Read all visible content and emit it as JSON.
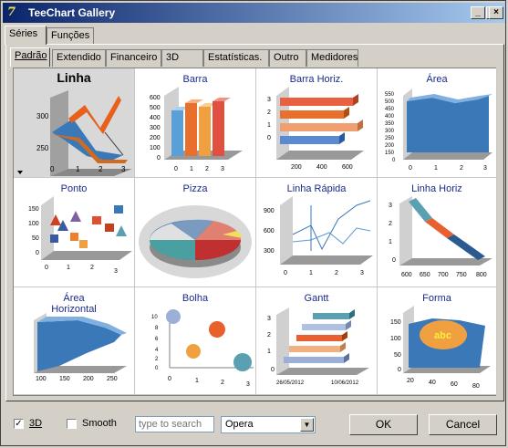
{
  "window": {
    "title": "TeeChart Gallery",
    "icon_name": "teechart-app-icon",
    "minimize": "_",
    "maximize": "□",
    "close": "×"
  },
  "outer_tabs": [
    {
      "label": "Séries",
      "active": true
    },
    {
      "label": "Funções",
      "active": false
    }
  ],
  "inner_tabs": [
    {
      "label": "Padrão",
      "active": true
    },
    {
      "label": "Extendido",
      "active": false
    },
    {
      "label": "Financeiro",
      "active": false
    },
    {
      "label": "3D",
      "active": false
    },
    {
      "label": "Estatísticas.",
      "active": false
    },
    {
      "label": "Outro",
      "active": false
    },
    {
      "label": "Medidores",
      "active": false
    }
  ],
  "gallery": [
    {
      "title": "Linha",
      "selected": true,
      "kind": "line",
      "y_ticks": [
        "250",
        "300"
      ],
      "x_ticks": [
        "0",
        "1",
        "2",
        "3"
      ]
    },
    {
      "title": "Barra",
      "kind": "bar",
      "y_ticks": [
        "0",
        "100",
        "200",
        "300",
        "400",
        "500",
        "600"
      ],
      "x_ticks": [
        "0",
        "1",
        "2",
        "3"
      ]
    },
    {
      "title": "Barra Horiz.",
      "kind": "hbar",
      "y_ticks": [
        "0",
        "1",
        "2",
        "3"
      ],
      "x_ticks": [
        "200",
        "400",
        "600"
      ]
    },
    {
      "title": "Área",
      "kind": "area",
      "y_ticks": [
        "0",
        "150",
        "200",
        "250",
        "300",
        "350",
        "400",
        "450",
        "500",
        "550"
      ],
      "x_ticks": [
        "0",
        "1",
        "2",
        "3"
      ]
    },
    {
      "title": "Ponto",
      "kind": "point",
      "y_ticks": [
        "0",
        "50",
        "100",
        "150"
      ],
      "x_ticks": [
        "0",
        "1",
        "2",
        "3"
      ]
    },
    {
      "title": "Pizza",
      "kind": "pie",
      "y_ticks": [],
      "x_ticks": []
    },
    {
      "title": "Linha Rápida",
      "kind": "fastline",
      "y_ticks": [
        "300",
        "600",
        "900"
      ],
      "x_ticks": [
        "0",
        "1",
        "2",
        "3"
      ]
    },
    {
      "title": "Linha Horiz",
      "kind": "hline",
      "y_ticks": [
        "0",
        "1",
        "2",
        "3"
      ],
      "x_ticks": [
        "600",
        "650",
        "700",
        "750",
        "800"
      ]
    },
    {
      "title": "Área\nHorizontal",
      "kind": "harea",
      "y_ticks": [],
      "x_ticks": [
        "100",
        "150",
        "200",
        "250"
      ]
    },
    {
      "title": "Bolha",
      "kind": "bubble",
      "y_ticks": [
        "0",
        "2",
        "4",
        "6",
        "8",
        "10"
      ],
      "x_ticks": [
        "0",
        "1",
        "2",
        "3"
      ]
    },
    {
      "title": "Gantt",
      "kind": "gantt",
      "y_ticks": [
        "0",
        "1",
        "2",
        "3"
      ],
      "x_ticks": [
        "26/05/2012",
        "10/06/2012"
      ]
    },
    {
      "title": "Forma",
      "kind": "shape",
      "y_ticks": [
        "0",
        "50",
        "100",
        "150"
      ],
      "x_ticks": [
        "20",
        "40",
        "60",
        "80"
      ],
      "shape_text": "abc"
    }
  ],
  "options": {
    "three_d_label": "3D",
    "three_d_checked": true,
    "smooth_label": "Smooth",
    "smooth_checked": false,
    "search_placeholder": "type to search",
    "theme_value": "Opera"
  },
  "buttons": {
    "ok": "OK",
    "cancel": "Cancel"
  },
  "colors": {
    "title_start": "#0a246a",
    "title_end": "#a6caf0",
    "chart_title": "#1a2a88"
  }
}
